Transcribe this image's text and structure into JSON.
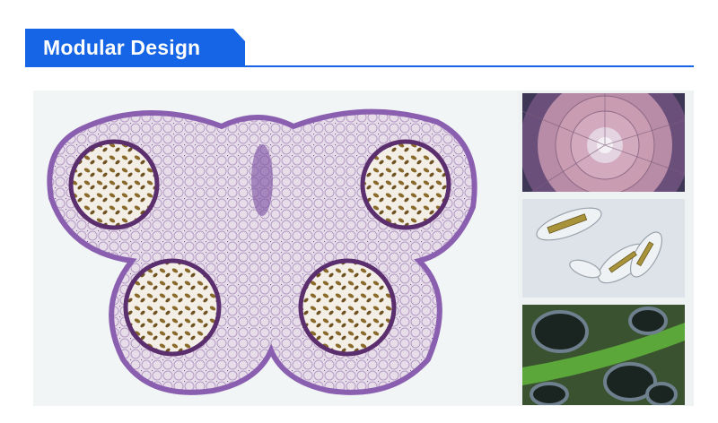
{
  "header": {
    "title": "Modular Design",
    "accent_color": "#1565e6"
  },
  "gallery": {
    "main_image": "microscope-slide-anther-cross-section",
    "side_images": [
      "microscope-slide-stem-cross-section",
      "microscope-slide-pollen-grains",
      "microscope-slide-tissue-green-stain"
    ]
  }
}
